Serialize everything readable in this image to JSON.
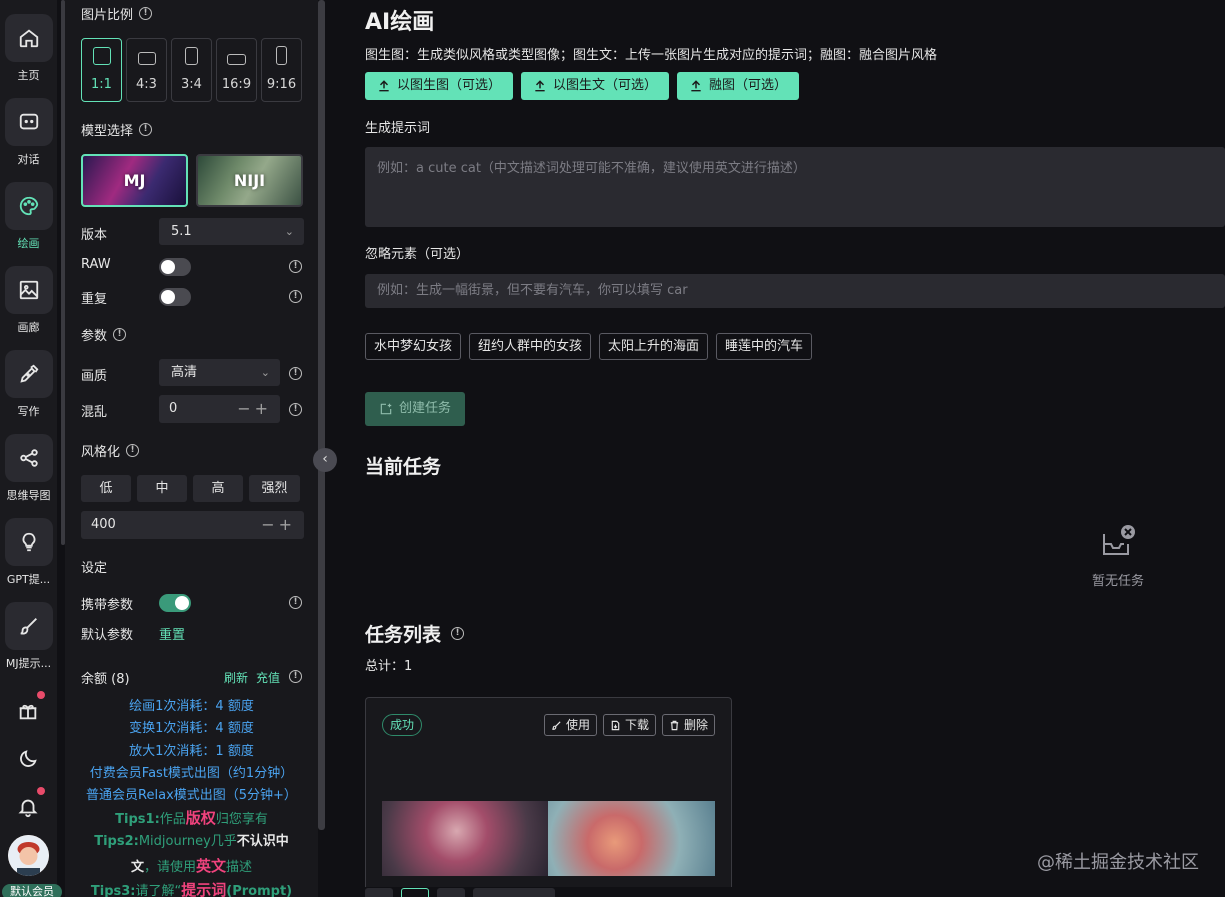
{
  "nav": {
    "items": [
      {
        "label": "主页",
        "icon": "home-icon"
      },
      {
        "label": "对话",
        "icon": "chat-icon"
      },
      {
        "label": "绘画",
        "icon": "palette-icon",
        "active": true
      },
      {
        "label": "画廊",
        "icon": "gallery-icon"
      },
      {
        "label": "写作",
        "icon": "pen-icon"
      },
      {
        "label": "思维导图",
        "icon": "mindmap-icon"
      },
      {
        "label": "GPT提...",
        "icon": "lightbulb-icon"
      },
      {
        "label": "MJ提示...",
        "icon": "brush-icon"
      }
    ],
    "member_badge": "默认会员"
  },
  "settings": {
    "ratio_title": "图片比例",
    "ratios": [
      "1:1",
      "4:3",
      "3:4",
      "16:9",
      "9:16"
    ],
    "model_title": "模型选择",
    "models": [
      "MJ",
      "NIJI"
    ],
    "version_label": "版本",
    "version_value": "5.1",
    "raw_label": "RAW",
    "repeat_label": "重复",
    "params_title": "参数",
    "quality_label": "画质",
    "quality_value": "高清",
    "chaos_label": "混乱",
    "chaos_value": "0",
    "stylize_title": "风格化",
    "stylize_options": [
      "低",
      "中",
      "高",
      "强烈"
    ],
    "stylize_value": "400",
    "setup_title": "设定",
    "carry_params_label": "携带参数",
    "default_params_label": "默认参数",
    "reset_label": "重置",
    "balance_label": "余额 (8)",
    "refresh_label": "刷新",
    "recharge_label": "充值",
    "costs": [
      "绘画1次消耗：4 额度",
      "变换1次消耗：4 额度",
      "放大1次消耗：1 额度",
      "付费会员Fast模式出图（约1分钟）",
      "普通会员Relax模式出图（5分钟+）"
    ],
    "tips1_a": "Tips1:",
    "tips1_b": "作品",
    "tips1_c": "版权",
    "tips1_d": "归您享有",
    "tips2_a": "Tips2:",
    "tips2_b": "Midjourney几乎",
    "tips2_c": "不认识中",
    "tips2_d": "文",
    "tips2_e": "，请使用",
    "tips2_f": "英文",
    "tips2_g": "描述",
    "tips3_a": "Tips3:",
    "tips3_b": "请了解“",
    "tips3_c": "提示词",
    "tips3_d": "(Prompt)"
  },
  "main": {
    "title": "AI绘画",
    "description": "图生图：生成类似风格或类型图像；图生文：上传一张图片生成对应的提示词；融图：融合图片风格",
    "upload_buttons": [
      "以图生图（可选）",
      "以图生文（可选）",
      "融图（可选）"
    ],
    "prompt_label": "生成提示词",
    "prompt_placeholder": "例如：a cute cat（中文描述词处理可能不准确，建议使用英文进行描述）",
    "negative_label": "忽略元素（可选）",
    "negative_placeholder": "例如：生成一幅街景，但不要有汽车，你可以填写 car",
    "presets": [
      "水中梦幻女孩",
      "纽约人群中的女孩",
      "太阳上升的海面",
      "睡莲中的汽车"
    ],
    "create_label": "创建任务",
    "current_tasks_title": "当前任务",
    "empty_text": "暂无任务",
    "task_list_title": "任务列表",
    "total_text": "总计：1",
    "task": {
      "status": "成功",
      "actions": [
        "使用",
        "下载",
        "删除"
      ]
    },
    "watermark": "@稀土掘金技术社区"
  },
  "colors": {
    "accent": "#63e2b7",
    "background": "#101014",
    "panel": "#18181c",
    "input": "#2a2a30",
    "link_blue": "#4aa3f0",
    "tips_green": "#2f9f7a",
    "tips_pink": "#f0437d"
  }
}
